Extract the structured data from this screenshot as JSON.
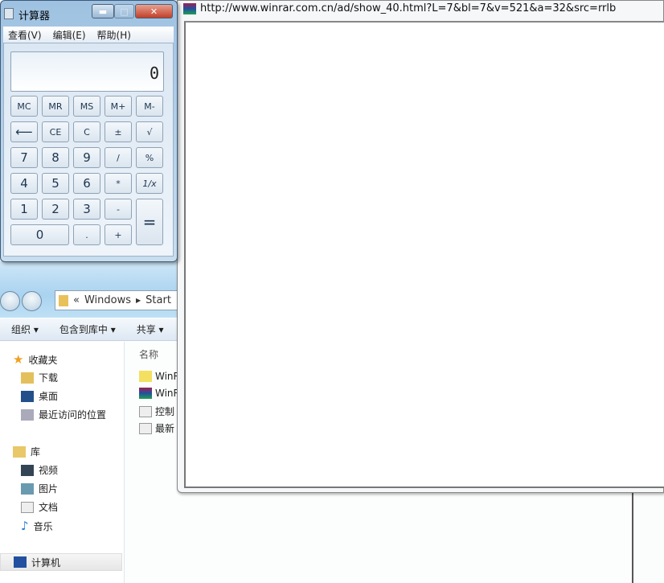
{
  "calculator": {
    "title": "计算器",
    "menu": [
      "查看(V)",
      "编辑(E)",
      "帮助(H)"
    ],
    "display": "0",
    "keys": {
      "mc": "MC",
      "mr": "MR",
      "ms": "MS",
      "mplus": "M+",
      "mminus": "M-",
      "back": "⟵",
      "ce": "CE",
      "c": "C",
      "pm": "±",
      "sqrt": "√",
      "k7": "7",
      "k8": "8",
      "k9": "9",
      "div": "/",
      "pct": "%",
      "k4": "4",
      "k5": "5",
      "k6": "6",
      "mul": "*",
      "inv": "1/x",
      "k1": "1",
      "k2": "2",
      "k3": "3",
      "sub": "-",
      "eq": "=",
      "k0": "0",
      "dot": ".",
      "add": "+"
    }
  },
  "ad_window": {
    "url": "http://www.winrar.com.cn/ad/show_40.html?L=7&bl=7&v=521&a=32&src=rrlb"
  },
  "explorer": {
    "address": {
      "prefix": "«",
      "crumbs": [
        "Windows",
        "Start"
      ]
    },
    "toolbar": [
      "组织",
      "包含到库中",
      "共享"
    ],
    "nav": {
      "favorites": "收藏夹",
      "fav_items": [
        "下载",
        "桌面",
        "最近访问的位置"
      ],
      "library": "库",
      "lib_items": [
        "视频",
        "图片",
        "文档",
        "音乐"
      ],
      "computer": "计算机"
    },
    "column_header": "名称",
    "files": [
      "WinRAR",
      "WinRAR",
      "控制",
      "最新"
    ]
  }
}
